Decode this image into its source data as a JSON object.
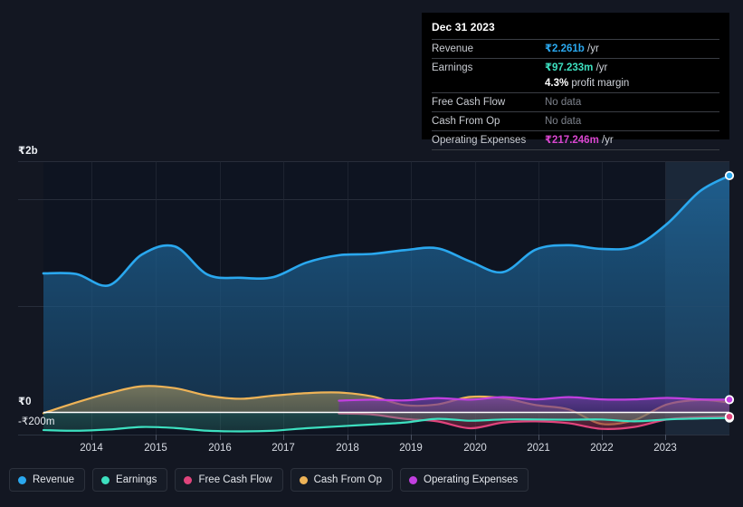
{
  "theme": {
    "background": "#131722",
    "plot_background": "#0f1420",
    "grid_color": "#252b38",
    "zero_line": "#ffffff",
    "forecast_band": "#1b2636"
  },
  "tooltip": {
    "date": "Dec 31 2023",
    "rows": [
      {
        "label": "Revenue",
        "value": "₹2.261b",
        "unit": "/yr",
        "color": "#2aa8ef",
        "no_data": false
      },
      {
        "label": "Earnings",
        "value": "₹97.233m",
        "unit": "/yr",
        "color": "#3de0c0",
        "no_data": false
      },
      {
        "label": "",
        "value": "4.3%",
        "unit": "profit margin",
        "color": "#ffffff",
        "no_data": false
      },
      {
        "label": "Free Cash Flow",
        "value": "No data",
        "unit": "",
        "color": "#7d828c",
        "no_data": true
      },
      {
        "label": "Cash From Op",
        "value": "No data",
        "unit": "",
        "color": "#7d828c",
        "no_data": true
      },
      {
        "label": "Operating Expenses",
        "value": "₹217.246m",
        "unit": "/yr",
        "color": "#d946cf",
        "no_data": false
      }
    ]
  },
  "legend": {
    "items": [
      {
        "label": "Revenue",
        "color": "#2aa8ef"
      },
      {
        "label": "Earnings",
        "color": "#3de0c0"
      },
      {
        "label": "Free Cash Flow",
        "color": "#e0447c"
      },
      {
        "label": "Cash From Op",
        "color": "#eeb357"
      },
      {
        "label": "Operating Expenses",
        "color": "#c23fe0"
      }
    ]
  },
  "chart_data": {
    "type": "area",
    "title": "",
    "xlabel": "",
    "ylabel": "",
    "currency": "INR",
    "x_tick_labels": [
      "2014",
      "2015",
      "2016",
      "2017",
      "2018",
      "2019",
      "2020",
      "2021",
      "2022",
      "2023"
    ],
    "y_tick_labels": [
      "₹2b",
      "₹0",
      "-₹200m"
    ],
    "ylim": [
      -200000000,
      2200000000
    ],
    "grid": true,
    "legend_position": "bottom",
    "zero_line": 0,
    "forecast_band": {
      "from": "2023.0",
      "to": "2023.95",
      "label": ""
    },
    "endpoint_markers": [
      "Revenue",
      "Earnings",
      "Operating Expenses",
      "Free Cash Flow"
    ],
    "x": [
      2013.5,
      2014.0,
      2014.5,
      2015.0,
      2015.5,
      2016.0,
      2016.5,
      2017.0,
      2017.5,
      2018.0,
      2018.5,
      2019.0,
      2019.5,
      2020.0,
      2020.5,
      2021.0,
      2021.5,
      2022.0,
      2022.5,
      2023.0,
      2023.5,
      2023.95
    ],
    "series": [
      {
        "name": "Revenue",
        "color": "#2aa8ef",
        "fill": "rgba(30,110,170,0.45)",
        "unit": "INR",
        "values": [
          1.105,
          1.1,
          1.01,
          1.255,
          1.32,
          1.095,
          1.07,
          1.075,
          1.19,
          1.25,
          1.26,
          1.29,
          1.305,
          1.2,
          1.115,
          1.295,
          1.33,
          1.3,
          1.32,
          1.5,
          1.76,
          1.885
        ],
        "value_scale": "billions",
        "last_value": "₹2.261b"
      },
      {
        "name": "Earnings",
        "color": "#3de0c0",
        "fill": "rgba(60,200,175,0.18)",
        "unit": "INR",
        "values": [
          -0.145,
          -0.15,
          -0.14,
          -0.12,
          -0.128,
          -0.15,
          -0.155,
          -0.15,
          -0.13,
          -0.115,
          -0.1,
          -0.085,
          -0.055,
          -0.07,
          -0.06,
          -0.06,
          -0.062,
          -0.06,
          -0.075,
          -0.06,
          -0.052,
          -0.048
        ],
        "value_scale": "billions",
        "last_value": "₹97.233m"
      },
      {
        "name": "Free Cash Flow",
        "color": "#e0447c",
        "fill": "rgba(200,50,110,0.30)",
        "unit": "INR",
        "values": [
          null,
          null,
          null,
          null,
          null,
          null,
          null,
          null,
          null,
          -0.012,
          -0.02,
          -0.055,
          -0.075,
          -0.13,
          -0.085,
          -0.075,
          -0.09,
          -0.135,
          -0.12,
          -0.06,
          -0.042,
          -0.038
        ],
        "value_scale": "billions",
        "last_value": "No data"
      },
      {
        "name": "Cash From Op",
        "color": "#eeb357",
        "fill": "rgba(150,135,95,0.45)",
        "unit": "INR",
        "values": [
          -0.01,
          0.075,
          0.15,
          0.205,
          0.19,
          0.13,
          0.105,
          0.13,
          0.15,
          0.155,
          0.125,
          0.055,
          0.06,
          0.12,
          0.11,
          0.055,
          0.02,
          -0.095,
          -0.065,
          0.06,
          0.095,
          0.075
        ],
        "value_scale": "billions",
        "last_value": "No data"
      },
      {
        "name": "Operating Expenses",
        "color": "#c23fe0",
        "fill": "rgba(120,50,160,0.45)",
        "unit": "INR",
        "values": [
          null,
          null,
          null,
          null,
          null,
          null,
          null,
          null,
          null,
          0.09,
          0.098,
          0.092,
          0.11,
          0.098,
          0.118,
          0.1,
          0.118,
          0.1,
          0.1,
          0.112,
          0.1,
          0.098
        ],
        "value_scale": "billions",
        "last_value": "₹217.246m"
      }
    ]
  }
}
